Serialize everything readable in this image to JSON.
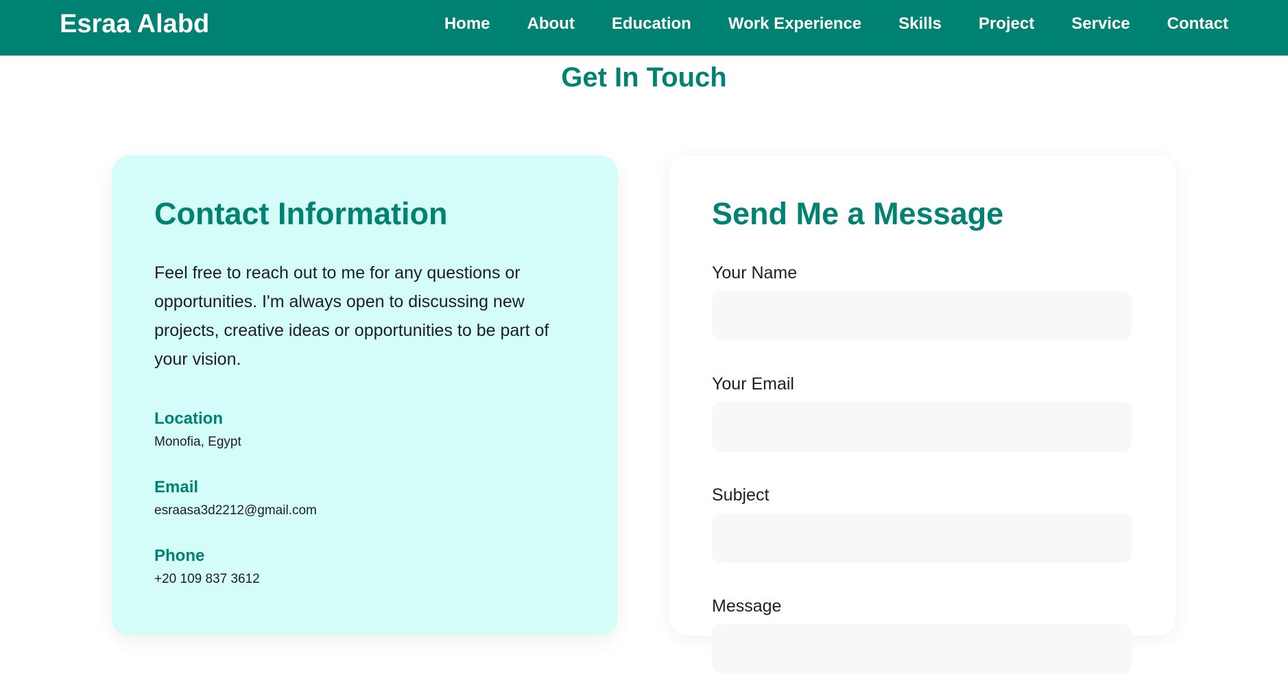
{
  "header": {
    "brand": "Esraa Alabd",
    "nav": [
      {
        "label": "Home"
      },
      {
        "label": "About"
      },
      {
        "label": "Education"
      },
      {
        "label": "Work Experience"
      },
      {
        "label": "Skills"
      },
      {
        "label": "Project"
      },
      {
        "label": "Service"
      },
      {
        "label": "Contact"
      }
    ]
  },
  "section": {
    "title": "Get In Touch"
  },
  "contact_info": {
    "title": "Contact Information",
    "intro": "Feel free to reach out to me for any questions or opportunities. I'm always open to discussing new projects, creative ideas or opportunities to be part of your vision.",
    "items": [
      {
        "label": "Location",
        "value": "Monofia, Egypt"
      },
      {
        "label": "Email",
        "value": "esraasa3d2212@gmail.com"
      },
      {
        "label": "Phone",
        "value": "+20 109 837 3612"
      }
    ]
  },
  "message_form": {
    "title": "Send Me a Message",
    "fields": [
      {
        "label": "Your Name",
        "value": ""
      },
      {
        "label": "Your Email",
        "value": ""
      },
      {
        "label": "Subject",
        "value": ""
      },
      {
        "label": "Message",
        "value": ""
      }
    ]
  },
  "colors": {
    "primary": "#008272",
    "info_card_bg": "#d4fcf8",
    "input_bg": "#f7f8fa",
    "text": "#1f1f1f"
  }
}
